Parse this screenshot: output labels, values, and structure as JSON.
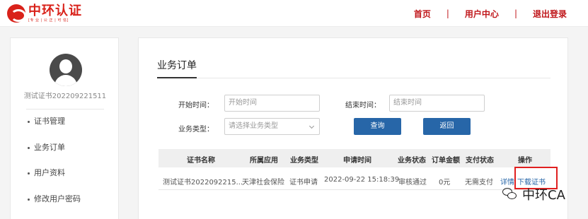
{
  "header": {
    "logo_title": "中环认证",
    "logo_subtitle": "[专 业 | 公 正 | 可 信]",
    "nav": [
      "首页",
      "用户中心",
      "退出登录"
    ],
    "nav_separator": "|",
    "brand_color": "#c0171b"
  },
  "sidebar": {
    "username": "测试证书202209221511",
    "items": [
      {
        "label": "证书管理"
      },
      {
        "label": "业务订单"
      },
      {
        "label": "用户资料"
      },
      {
        "label": "修改用户密码"
      }
    ]
  },
  "main": {
    "title": "业务订单",
    "filters": {
      "start_label": "开始时间：",
      "start_placeholder": "开始时间",
      "end_label": "结束时间：",
      "end_placeholder": "结束时间",
      "type_label": "业务类型：",
      "type_placeholder": "请选择业务类型"
    },
    "buttons": {
      "search": "查询",
      "back": "返回"
    },
    "button_color": "#2766a8",
    "table": {
      "headers": [
        "证书名称",
        "所属应用",
        "业务类型",
        "申请时间",
        "业务状态",
        "订单金额",
        "支付状态",
        "操作"
      ],
      "rows": [
        {
          "name": "测试证书2022092215...",
          "app": "天津社会保险",
          "type": "证书申请",
          "time": "2022-09-22 15:18:39",
          "status": "审核通过",
          "amount": "0元",
          "pay_status": "无需支付",
          "actions": [
            "详情",
            "下载证书"
          ]
        }
      ]
    }
  },
  "watermark": {
    "text": "中环CA",
    "icon": "wechat-icon"
  }
}
